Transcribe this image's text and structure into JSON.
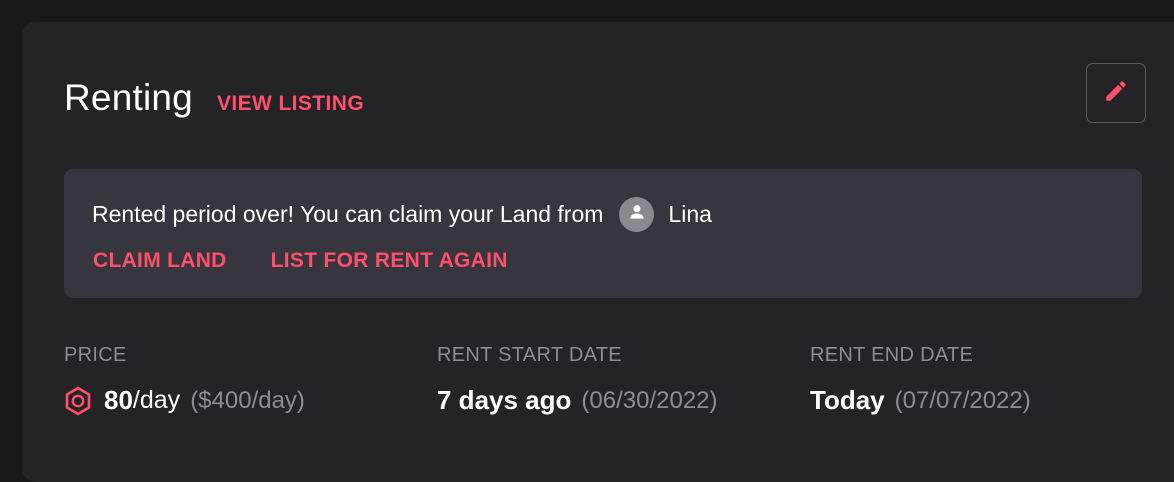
{
  "header": {
    "title": "Renting",
    "view_listing": "VIEW LISTING"
  },
  "notice": {
    "message": "Rented period over! You can claim your Land from",
    "user_name": "Lina",
    "claim_label": "CLAIM LAND",
    "relist_label": "LIST FOR RENT AGAIN"
  },
  "stats": {
    "price": {
      "label": "PRICE",
      "amount": "80",
      "unit": "/day",
      "fiat": "($400/day)"
    },
    "start": {
      "label": "RENT START DATE",
      "relative": "7 days ago",
      "date": "(06/30/2022)"
    },
    "end": {
      "label": "RENT END DATE",
      "relative": "Today",
      "date": "(07/07/2022)"
    }
  },
  "icons": {
    "edit": "pencil-icon",
    "avatar": "user-icon",
    "currency": "mana-icon"
  },
  "colors": {
    "accent": "#ff4f6a",
    "card": "#242328",
    "notice": "#37353d",
    "muted": "#8e8c94"
  }
}
